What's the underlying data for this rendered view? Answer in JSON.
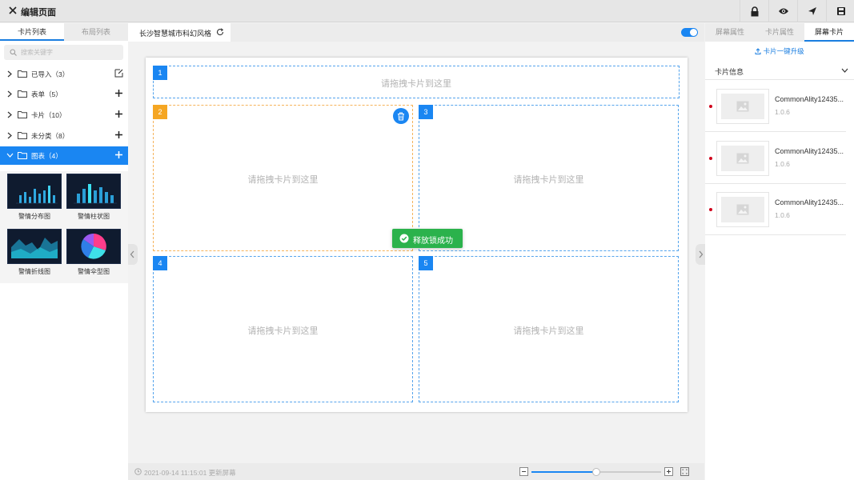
{
  "header": {
    "title": "编辑页面"
  },
  "left_panel": {
    "tabs": [
      {
        "label": "卡片列表"
      },
      {
        "label": "布局列表"
      }
    ],
    "search_placeholder": "搜索关键字",
    "tree": [
      {
        "label": "已导入（3）",
        "action": "edit-icon"
      },
      {
        "label": "表单（5）",
        "action": "plus-icon"
      },
      {
        "label": "卡片（10）",
        "action": "plus-icon"
      },
      {
        "label": "未分类（8）",
        "action": "plus-icon"
      },
      {
        "label": "图表（4）",
        "action": "plus-icon"
      }
    ],
    "thumbnails": [
      {
        "label": "警情分布图"
      },
      {
        "label": "警情柱状图"
      },
      {
        "label": "警情折线图"
      },
      {
        "label": "警情伞型图"
      }
    ]
  },
  "center": {
    "tab_label": "长沙智慧城市科幻风格",
    "toggle_on": true,
    "slots": [
      {
        "num": "1",
        "placeholder": "请拖拽卡片到这里"
      },
      {
        "num": "2",
        "placeholder": "请拖拽卡片到这里"
      },
      {
        "num": "3",
        "placeholder": "请拖拽卡片到这里"
      },
      {
        "num": "4",
        "placeholder": "请拖拽卡片到这里"
      },
      {
        "num": "5",
        "placeholder": "请拖拽卡片到这里"
      }
    ],
    "toast": "释放锁成功",
    "status_text": "2021-09-14 11:15:01 更新屏幕",
    "zoom_fraction": 0.5
  },
  "right_panel": {
    "tabs": [
      {
        "label": "屏幕属性"
      },
      {
        "label": "卡片属性"
      },
      {
        "label": "屏幕卡片"
      }
    ],
    "upgrade_label": "卡片一键升级",
    "section_title": "卡片信息",
    "cards": [
      {
        "name": "CommonAlity12435...",
        "version": "1.0.6"
      },
      {
        "name": "CommonAlity12435...",
        "version": "1.0.6"
      },
      {
        "name": "CommonAlity12435...",
        "version": "1.0.6"
      }
    ]
  },
  "colors": {
    "accent": "#1a86f2",
    "selected_slot": "#f5a623",
    "toast": "#2bb24c",
    "dot": "#d0021b"
  }
}
